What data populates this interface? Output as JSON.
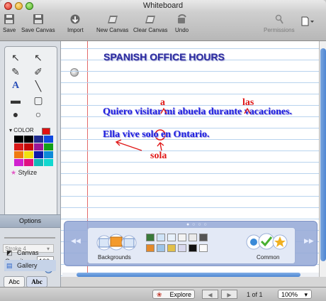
{
  "window": {
    "title": "Whiteboard"
  },
  "toolbar": {
    "save": "Save",
    "save_canvas": "Save Canvas",
    "import": "Import",
    "new_canvas": "New Canvas",
    "clear_canvas": "Clear Canvas",
    "undo": "Undo",
    "permissions": "Permissions"
  },
  "left_panel": {
    "color_label": "COLOR",
    "stylize": "Stylize",
    "options": "Options",
    "stroke": "Stroke 4",
    "opacity_label": "Opacity",
    "opacity_value": "100",
    "font_a": "Abc",
    "font_b": "Abc",
    "canvas": "Canvas",
    "gallery": "Gallery",
    "palette": [
      "#000000",
      "#000000",
      "#1f2b8f",
      "#0f49e0",
      "#d81818",
      "#c50707",
      "#9a1898",
      "#12a018",
      "#f07a10",
      "#f0e010",
      "#0e1aa8",
      "#0d8ad8",
      "#d020d0",
      "#e01080",
      "#10b8b8",
      "#10d8d0"
    ]
  },
  "whiteboard": {
    "heading": "SPANISH OFFICE HOURS",
    "sentence1": "Quiero visitar mi abuela durante vacaciones.",
    "sentence2": "Ella vive solo en Ontario.",
    "correction_a": "a",
    "correction_las": "las",
    "correction_sola": "sola"
  },
  "media": {
    "backgrounds": "Backgrounds",
    "common": "Common"
  },
  "bottom": {
    "explore": "Explore",
    "page": "1 of 1",
    "zoom": "100%"
  }
}
